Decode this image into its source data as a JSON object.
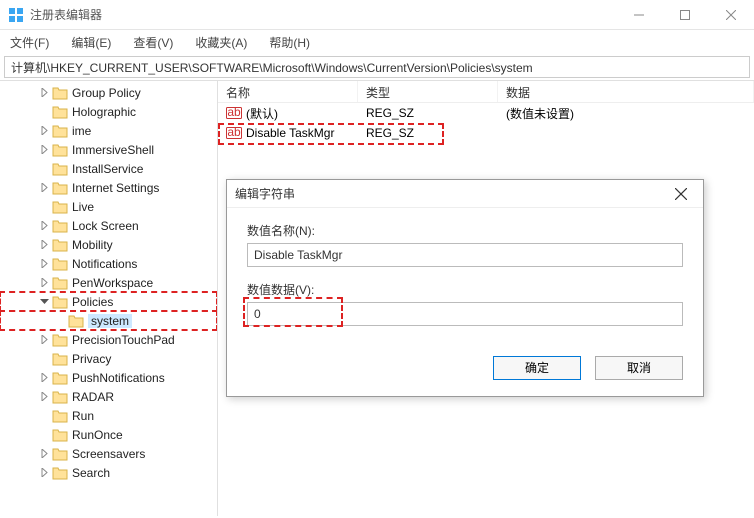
{
  "title": "注册表编辑器",
  "menus": [
    "文件(F)",
    "编辑(E)",
    "查看(V)",
    "收藏夹(A)",
    "帮助(H)"
  ],
  "address": "计算机\\HKEY_CURRENT_USER\\SOFTWARE\\Microsoft\\Windows\\CurrentVersion\\Policies\\system",
  "tree": [
    {
      "indent": 2,
      "expander": "right",
      "label": "Group Policy"
    },
    {
      "indent": 2,
      "expander": "none",
      "label": "Holographic"
    },
    {
      "indent": 2,
      "expander": "right",
      "label": "ime"
    },
    {
      "indent": 2,
      "expander": "right",
      "label": "ImmersiveShell"
    },
    {
      "indent": 2,
      "expander": "none",
      "label": "InstallService"
    },
    {
      "indent": 2,
      "expander": "right",
      "label": "Internet Settings"
    },
    {
      "indent": 2,
      "expander": "none",
      "label": "Live"
    },
    {
      "indent": 2,
      "expander": "right",
      "label": "Lock Screen"
    },
    {
      "indent": 2,
      "expander": "right",
      "label": "Mobility"
    },
    {
      "indent": 2,
      "expander": "right",
      "label": "Notifications"
    },
    {
      "indent": 2,
      "expander": "right",
      "label": "PenWorkspace"
    },
    {
      "indent": 2,
      "expander": "down",
      "label": "Policies",
      "highlight": true
    },
    {
      "indent": 3,
      "expander": "none",
      "label": "system",
      "selected": true,
      "highlight": true
    },
    {
      "indent": 2,
      "expander": "right",
      "label": "PrecisionTouchPad"
    },
    {
      "indent": 2,
      "expander": "none",
      "label": "Privacy"
    },
    {
      "indent": 2,
      "expander": "right",
      "label": "PushNotifications"
    },
    {
      "indent": 2,
      "expander": "right",
      "label": "RADAR"
    },
    {
      "indent": 2,
      "expander": "none",
      "label": "Run"
    },
    {
      "indent": 2,
      "expander": "none",
      "label": "RunOnce"
    },
    {
      "indent": 2,
      "expander": "right",
      "label": "Screensavers"
    },
    {
      "indent": 2,
      "expander": "right",
      "label": "Search"
    }
  ],
  "list": {
    "columns": {
      "name": "名称",
      "type": "类型",
      "data": "数据"
    },
    "rows": [
      {
        "name": "(默认)",
        "type": "REG_SZ",
        "data": "(数值未设置)"
      },
      {
        "name": "Disable TaskMgr",
        "type": "REG_SZ",
        "data": "",
        "highlight": true
      }
    ]
  },
  "dialog": {
    "title": "编辑字符串",
    "name_label": "数值名称(N):",
    "name_value": "Disable TaskMgr",
    "data_label": "数值数据(V):",
    "data_value": "0",
    "ok": "确定",
    "cancel": "取消"
  }
}
